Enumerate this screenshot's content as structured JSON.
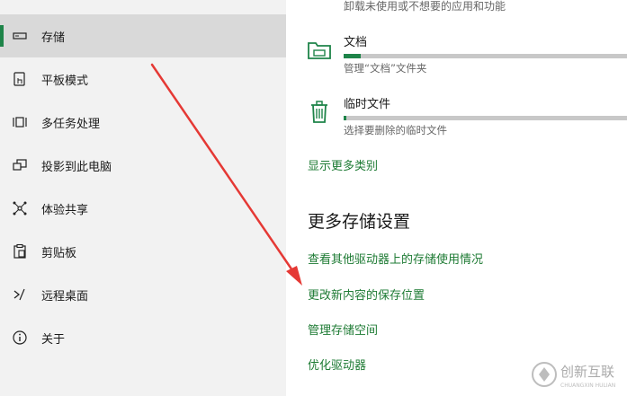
{
  "sidebar": {
    "items": [
      {
        "label": "存储",
        "icon": "storage-icon",
        "selected": true
      },
      {
        "label": "平板模式",
        "icon": "tablet-mode-icon",
        "selected": false
      },
      {
        "label": "多任务处理",
        "icon": "multitasking-icon",
        "selected": false
      },
      {
        "label": "投影到此电脑",
        "icon": "project-to-pc-icon",
        "selected": false
      },
      {
        "label": "体验共享",
        "icon": "shared-experiences-icon",
        "selected": false
      },
      {
        "label": "剪贴板",
        "icon": "clipboard-icon",
        "selected": false
      },
      {
        "label": "远程桌面",
        "icon": "remote-desktop-icon",
        "selected": false
      },
      {
        "label": "关于",
        "icon": "info-icon",
        "selected": false
      }
    ]
  },
  "main": {
    "top_desc": "卸载未使用或不想要的应用和功能",
    "categories": [
      {
        "title": "文档",
        "desc": "管理“文档”文件夹",
        "usage_fraction": 0.06,
        "icon": "folder-icon"
      },
      {
        "title": "临时文件",
        "desc": "选择要删除的临时文件",
        "usage_fraction": 0.01,
        "icon": "trash-icon"
      }
    ],
    "show_more": "显示更多类别",
    "section_title": "更多存储设置",
    "links": [
      "查看其他驱动器上的存储使用情况",
      "更改新内容的保存位置",
      "管理存储空间",
      "优化驱动器"
    ]
  },
  "colors": {
    "accent": "#1e8449",
    "link": "#1e7b34",
    "sidebar_bg": "#f2f2f2",
    "selected_bg": "#d9d9d9",
    "annotation_arrow": "#e53935"
  },
  "watermark": {
    "brand_text": "创新互联",
    "sub_text": "CHUANGXIN HULIAN"
  }
}
